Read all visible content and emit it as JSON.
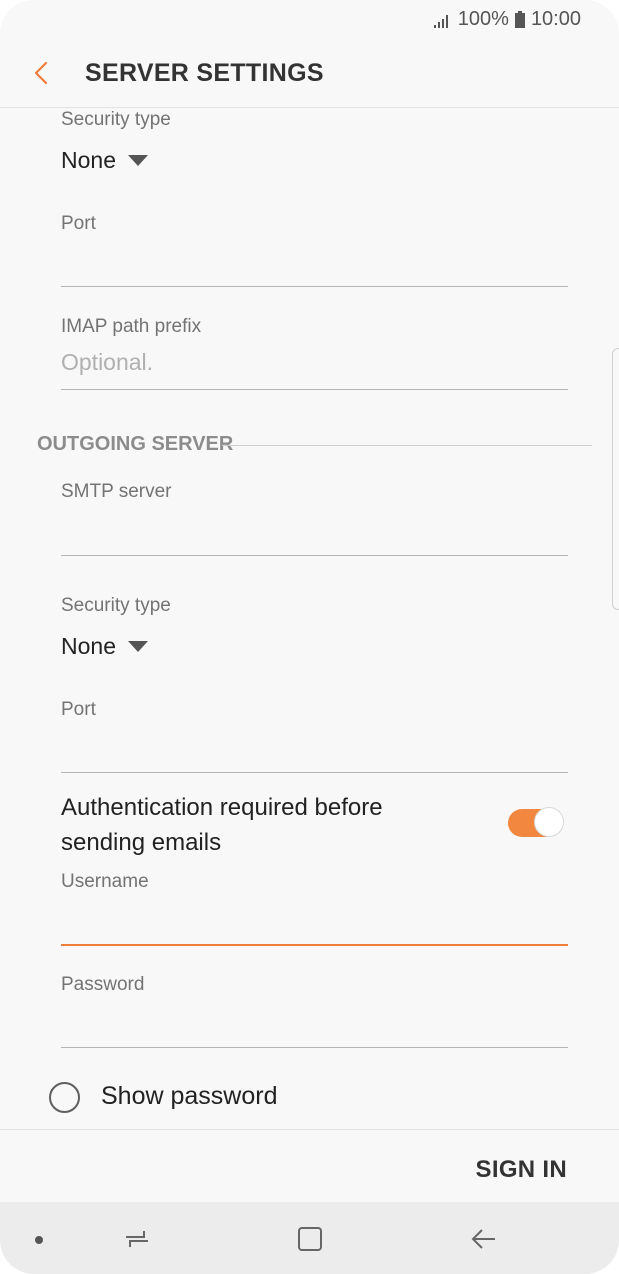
{
  "status_bar": {
    "battery": "100%",
    "time": "10:00"
  },
  "header": {
    "title": "SERVER SETTINGS"
  },
  "incoming": {
    "security_type_label": "Security type",
    "security_type_value": "None",
    "port_label": "Port",
    "imap_prefix_label": "IMAP path prefix",
    "imap_prefix_placeholder": "Optional."
  },
  "outgoing": {
    "section_title": "OUTGOING SERVER",
    "smtp_label": "SMTP server",
    "security_type_label": "Security type",
    "security_type_value": "None",
    "port_label": "Port"
  },
  "auth": {
    "label_line1": "Authentication required before",
    "label_line2": "sending emails",
    "enabled": true
  },
  "credentials": {
    "username_label": "Username",
    "password_label": "Password",
    "show_password_label": "Show password"
  },
  "actions": {
    "sign_in": "SIGN IN"
  },
  "colors": {
    "accent": "#ef7d3c",
    "toggle": "#f2873f"
  },
  "icons": [
    "back-arrow-icon",
    "signal-icon",
    "battery-icon",
    "dropdown-triangle-icon",
    "recents-icon",
    "home-icon",
    "back-nav-icon"
  ]
}
